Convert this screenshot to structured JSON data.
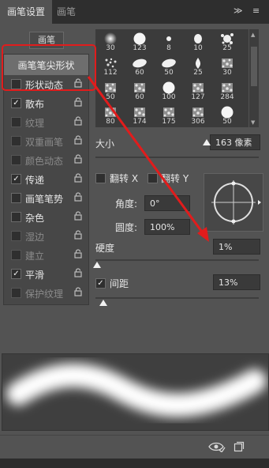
{
  "tabs": {
    "brush_settings": "画笔设置",
    "brushes": "画笔"
  },
  "tab_controls": {
    "expand": "≫",
    "menu": "≡"
  },
  "preset_button": "画笔",
  "options": [
    {
      "label": "画笔笔尖形状",
      "checked": null,
      "enabled": true,
      "has_lock": false
    },
    {
      "label": "形状动态",
      "checked": false,
      "enabled": true,
      "has_lock": true
    },
    {
      "label": "散布",
      "checked": true,
      "enabled": true,
      "has_lock": true
    },
    {
      "label": "纹理",
      "checked": false,
      "enabled": false,
      "has_lock": true
    },
    {
      "label": "双重画笔",
      "checked": false,
      "enabled": false,
      "has_lock": true
    },
    {
      "label": "颜色动态",
      "checked": false,
      "enabled": false,
      "has_lock": true
    },
    {
      "label": "传递",
      "checked": true,
      "enabled": true,
      "has_lock": true
    },
    {
      "label": "画笔笔势",
      "checked": false,
      "enabled": true,
      "has_lock": true
    },
    {
      "label": "杂色",
      "checked": false,
      "enabled": true,
      "has_lock": true
    },
    {
      "label": "湿边",
      "checked": false,
      "enabled": false,
      "has_lock": true
    },
    {
      "label": "建立",
      "checked": false,
      "enabled": false,
      "has_lock": true
    },
    {
      "label": "平滑",
      "checked": true,
      "enabled": true,
      "has_lock": true
    },
    {
      "label": "保护纹理",
      "checked": false,
      "enabled": false,
      "has_lock": true
    }
  ],
  "brush_presets": [
    {
      "size": "30",
      "shape": "soft"
    },
    {
      "size": "123",
      "shape": "hard"
    },
    {
      "size": "8",
      "shape": "speck"
    },
    {
      "size": "10",
      "shape": "blob"
    },
    {
      "size": "25",
      "shape": "splat"
    },
    {
      "size": "112",
      "shape": "dots"
    },
    {
      "size": "60",
      "shape": "smear"
    },
    {
      "size": "50",
      "shape": "smear"
    },
    {
      "size": "25",
      "shape": "drop"
    },
    {
      "size": "30",
      "shape": "grain"
    },
    {
      "size": "50",
      "shape": "grain"
    },
    {
      "size": "60",
      "shape": "grain"
    },
    {
      "size": "100",
      "shape": "hard"
    },
    {
      "size": "127",
      "shape": "grain"
    },
    {
      "size": "284",
      "shape": "grain"
    },
    {
      "size": "80",
      "shape": "grain"
    },
    {
      "size": "174",
      "shape": "grain"
    },
    {
      "size": "175",
      "shape": "grain"
    },
    {
      "size": "306",
      "shape": "grain"
    },
    {
      "size": "50",
      "shape": "hard"
    }
  ],
  "size": {
    "label": "大小",
    "value": "163 像素",
    "level": 0.68
  },
  "flip_x": {
    "label": "翻转 X",
    "checked": false
  },
  "flip_y": {
    "label": "翻转 Y",
    "checked": false
  },
  "angle": {
    "label": "角度:",
    "value": "0°"
  },
  "roundness": {
    "label": "圆度:",
    "value": "100%"
  },
  "hardness": {
    "label": "硬度",
    "value": "1%",
    "level": 0.01
  },
  "spacing": {
    "label": "间距",
    "value": "13%",
    "checked": true,
    "level": 0.05
  },
  "bottom_icons": [
    "brush-eye-icon",
    "new-brush-icon"
  ],
  "colors": {
    "annotation": "#e11c1c",
    "panel": "#535353",
    "tab_bar": "#2e2e2e"
  }
}
